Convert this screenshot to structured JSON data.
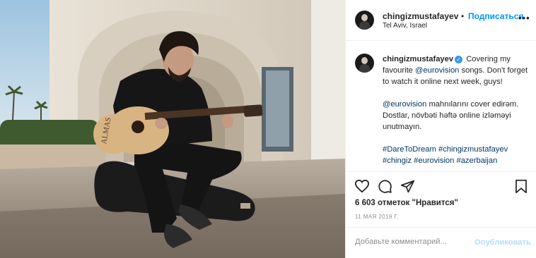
{
  "post": {
    "username": "chingizmustafayev",
    "follow_dot": "•",
    "follow_label": "Подписаться",
    "location": "Tel Aviv, Israel",
    "more_label": "•••",
    "photo_guitar_text": "ALMAS"
  },
  "caption": {
    "username": "chingizmustafayev",
    "verified_mark": "✓",
    "part1_a": "Covering my favourite",
    "part1_link": "@eurovision",
    "part1_b": "songs. Don't forget to watch it online next week, guys!",
    "part2_link": "@eurovision",
    "part2_b": "mahnılarını cover edirəm. Dostlar, növbəti həftə online izləməyi unutmayın.",
    "hashtags": [
      "#DareToDream",
      "#chingizmustafayev",
      "#chingiz",
      "#eurovision",
      "#azerbaijan"
    ]
  },
  "actions": {
    "likes": "6 603 отметок \"Нравится\"",
    "date": "11 МАЯ 2019 Г.",
    "comment_placeholder": "Добавьте комментарий...",
    "publish_label": "Опубликовать"
  },
  "colors": {
    "link": "#00376b",
    "follow": "#0095f6",
    "publish_disabled": "#b2dffc",
    "muted": "#8e8e8e"
  }
}
